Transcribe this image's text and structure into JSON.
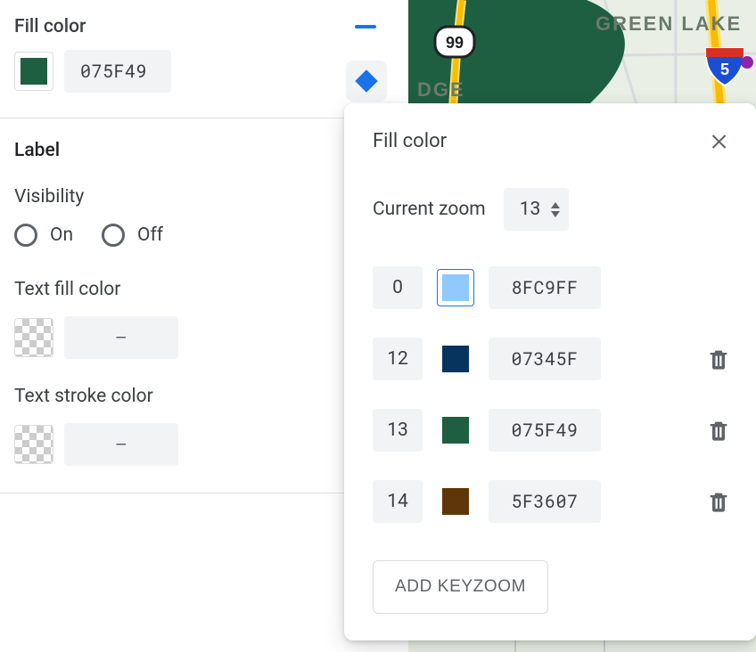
{
  "sidebar": {
    "fillColor": {
      "title": "Fill color",
      "hex": "075F49",
      "swatch": "#1e5f42"
    },
    "label": {
      "title": "Label",
      "visibility": {
        "title": "Visibility",
        "on": "On",
        "off": "Off"
      },
      "textFill": {
        "title": "Text fill color",
        "value": "–"
      },
      "textStroke": {
        "title": "Text stroke color",
        "value": "–"
      }
    }
  },
  "popup": {
    "title": "Fill color",
    "zoomLabel": "Current zoom",
    "zoomValue": "13",
    "keyzooms": [
      {
        "zoom": "0",
        "color": "#8FC9FF",
        "hex": "8FC9FF",
        "deletable": false,
        "outlined": true
      },
      {
        "zoom": "12",
        "color": "#07345F",
        "hex": "07345F",
        "deletable": true,
        "outlined": false
      },
      {
        "zoom": "13",
        "color": "#1e5f42",
        "hex": "075F49",
        "deletable": true,
        "outlined": false
      },
      {
        "zoom": "14",
        "color": "#5F3607",
        "hex": "5F3607",
        "deletable": true,
        "outlined": false
      }
    ],
    "addLabel": "ADD KEYZOOM"
  },
  "map": {
    "labels": {
      "greenLake": "GREEN LAKE",
      "dge": "DGE"
    },
    "shields": {
      "sr99": "99",
      "i5": "5"
    }
  }
}
